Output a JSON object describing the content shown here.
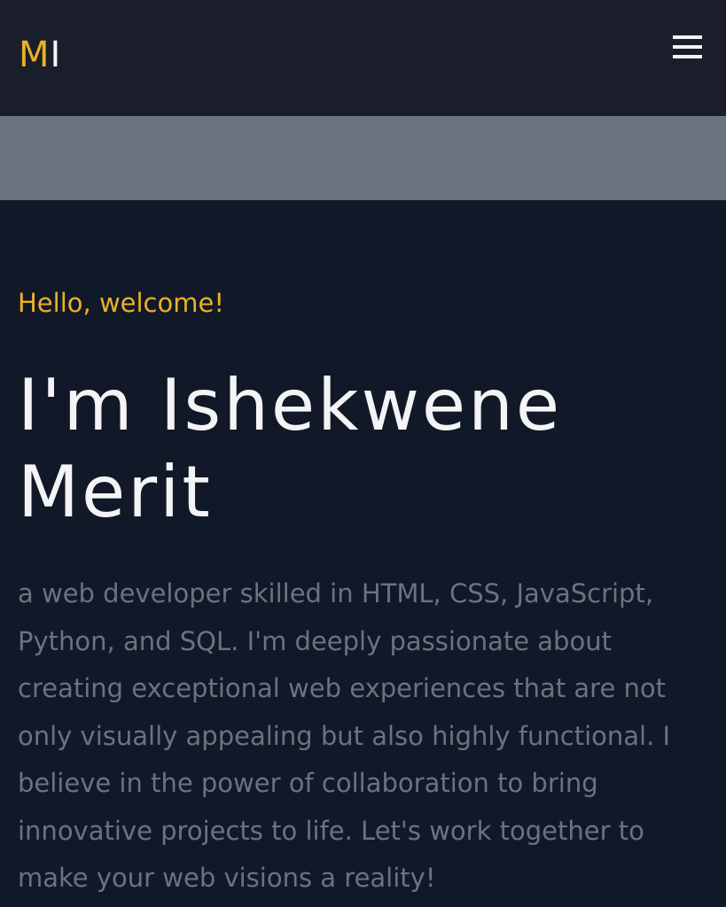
{
  "header": {
    "logo_first": "M",
    "logo_second": "I",
    "menu_icon": "hamburger-menu-icon"
  },
  "hero": {
    "greeting": "Hello, welcome!",
    "headline": "I'm Ishekwene Merit",
    "bio": "a web developer skilled in HTML, CSS, JavaScript, Python, and SQL. I'm deeply passionate about creating exceptional web experiences that are not only visually appealing but also highly functional. I believe in the power of collaboration to bring innovative projects to life. Let's work together to make your web visions a reality!"
  },
  "colors": {
    "header_bg": "#1a1d2a",
    "page_bg": "#111827",
    "banner_bg": "#6b7280",
    "accent": "#eab128",
    "heading_text": "#f3f4f6",
    "body_text": "#6b7280"
  }
}
